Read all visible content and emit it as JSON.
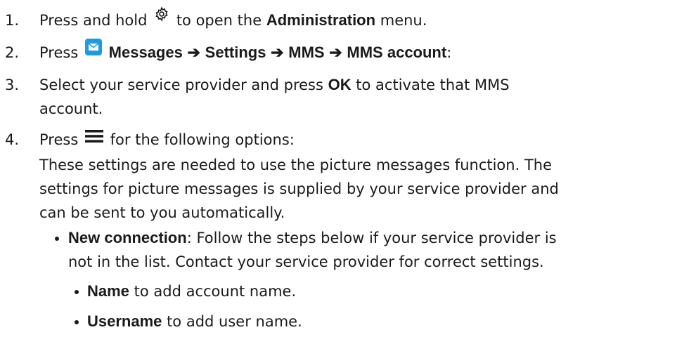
{
  "steps": [
    {
      "num": "1.",
      "pre": "Press and hold",
      "icon": "gear-icon",
      "mid": "to open the",
      "bold": "Administration",
      "post": "menu."
    },
    {
      "num": "2.",
      "pre": "Press",
      "icon": "messages-icon",
      "path": [
        "Messages",
        "Settings",
        "MMS",
        "MMS account"
      ],
      "arrow": "➔",
      "post": ":"
    },
    {
      "num": "3.",
      "pre": "Select your service provider and press",
      "bold": "OK",
      "post_line1": "to activate that MMS",
      "line2": "account."
    },
    {
      "num": "4.",
      "pre": "Press",
      "icon": "menu-icon",
      "post": "for the following options:"
    }
  ],
  "note": {
    "line1": "These settings are needed to use the picture messages function. The",
    "line2": "settings for picture messages is supplied by your service provider and",
    "line3": "can be sent to you automatically."
  },
  "bullets": [
    {
      "bold": "New connection",
      "line1": ": Follow the steps below if your service provider is",
      "line2": "not in the list. Contact your service provider for correct settings."
    }
  ],
  "sub_bullets": [
    {
      "bold": "Name",
      "text": "to add account name."
    },
    {
      "bold": "Username",
      "text": "to add user name."
    }
  ],
  "colors": {
    "text": "#1a1a1a",
    "icon_blue": "#1e9be0"
  }
}
